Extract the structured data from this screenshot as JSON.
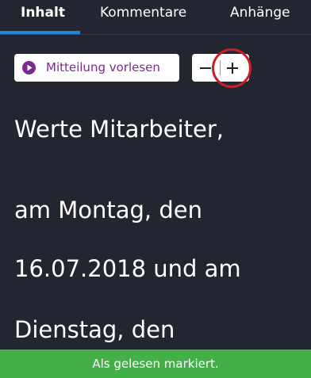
{
  "tabs": [
    {
      "label": "Inhalt",
      "active": true
    },
    {
      "label": "Kommentare",
      "active": false
    },
    {
      "label": "Anhänge",
      "active": false
    }
  ],
  "toolbar": {
    "read_aloud_label": "Mitteilung vorlesen",
    "read_aloud_icon": "play-circle-icon",
    "zoom_out_icon": "minus-icon",
    "zoom_in_icon": "plus-icon"
  },
  "message": {
    "lines": [
      "Werte Mitarbeiter,",
      "am Montag, den",
      "16.07.2018 und am",
      "Dienstag, den"
    ]
  },
  "toast": {
    "text": "Als gelesen markiert."
  },
  "colors": {
    "background": "#232630",
    "accent_tab": "#1e88d6",
    "read_aloud_text": "#7b2a90",
    "toast_bg": "#43b047",
    "highlight": "#c8202a"
  }
}
